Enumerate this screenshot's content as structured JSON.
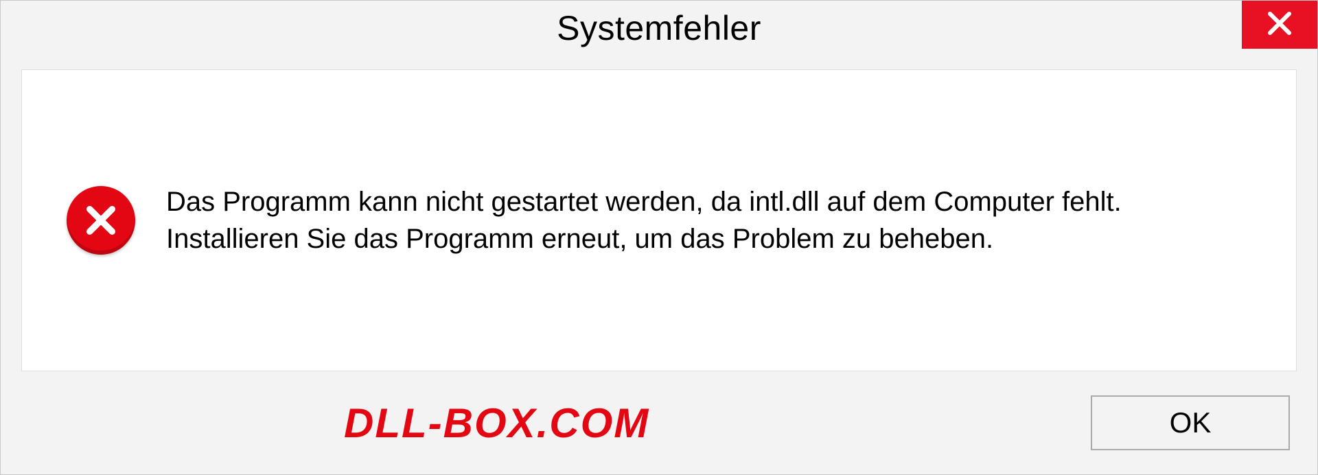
{
  "dialog": {
    "title": "Systemfehler",
    "message": "Das Programm kann nicht gestartet werden, da intl.dll auf dem Computer fehlt. Installieren Sie das Programm erneut, um das Problem zu beheben.",
    "ok_label": "OK"
  },
  "watermark": "DLL-BOX.COM"
}
